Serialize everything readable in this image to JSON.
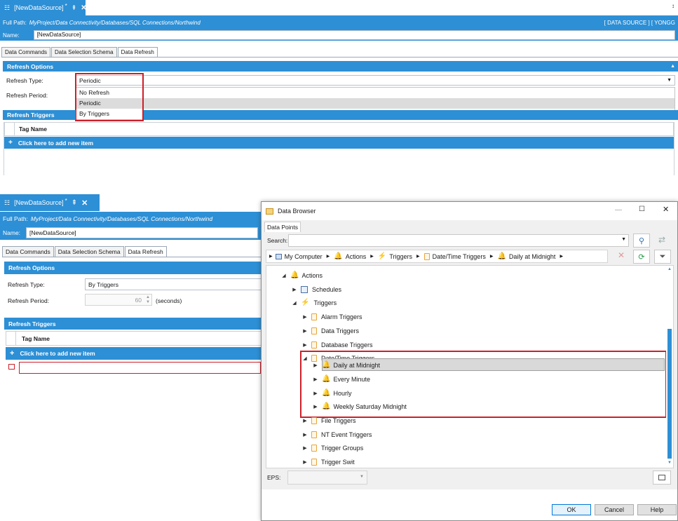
{
  "top": {
    "tab_title": "[NewDataSource]",
    "tab_mark": "*",
    "full_path_label": "Full Path:",
    "full_path": "MyProject/Data Connectivity/Databases/SQL Connections/Northwind",
    "right_info": "[ DATA SOURCE ] [ YONGG",
    "name_label": "Name:",
    "name_value": "[NewDataSource]",
    "tabs": [
      "Data Commands",
      "Data Selection Schema",
      "Data Refresh"
    ],
    "refresh_options": "Refresh Options",
    "refresh_type_label": "Refresh Type:",
    "refresh_type_value": "Periodic",
    "refresh_period_label": "Refresh Period:",
    "dropdown_options": [
      "No Refresh",
      "Periodic",
      "By Triggers"
    ],
    "refresh_triggers": "Refresh Triggers",
    "tag_name": "Tag Name",
    "add_item": "Click here to add new item"
  },
  "bottom": {
    "tab_title": "[NewDataSource]",
    "tab_mark": "*",
    "full_path_label": "Full Path:",
    "full_path": "MyProject/Data Connectivity/Databases/SQL Connections/Northwind",
    "name_label": "Name:",
    "name_value": "[NewDataSource]",
    "tabs": [
      "Data Commands",
      "Data Selection Schema",
      "Data Refresh"
    ],
    "refresh_options": "Refresh Options",
    "refresh_type_label": "Refresh Type:",
    "refresh_type_value": "By Triggers",
    "refresh_period_label": "Refresh Period:",
    "refresh_period_value": "60",
    "seconds": "(seconds)",
    "refresh_triggers": "Refresh Triggers",
    "tag_name": "Tag Name",
    "add_item": "Click here to add new item"
  },
  "dialog": {
    "title": "Data Browser",
    "tab": "Data Points",
    "search_label": "Search:",
    "breadcrumb": [
      "My Computer",
      "Actions",
      "Triggers",
      "Date/Time Triggers",
      "Daily at Midnight"
    ],
    "tree": {
      "actions": "Actions",
      "schedules": "Schedules",
      "triggers": "Triggers",
      "alarm": "Alarm Triggers",
      "data": "Data Triggers",
      "database": "Database Triggers",
      "datetime": "Date/Time Triggers",
      "daily": "Daily at Midnight",
      "every_minute": "Every Minute",
      "hourly": "Hourly",
      "weekly": "Weekly Saturday Midnight",
      "file": "File Triggers",
      "nt": "NT Event Triggers",
      "groups": "Trigger Groups",
      "partial": "Trigger Swit"
    },
    "eps_label": "EPS:",
    "ok": "OK",
    "cancel": "Cancel",
    "help": "Help"
  }
}
